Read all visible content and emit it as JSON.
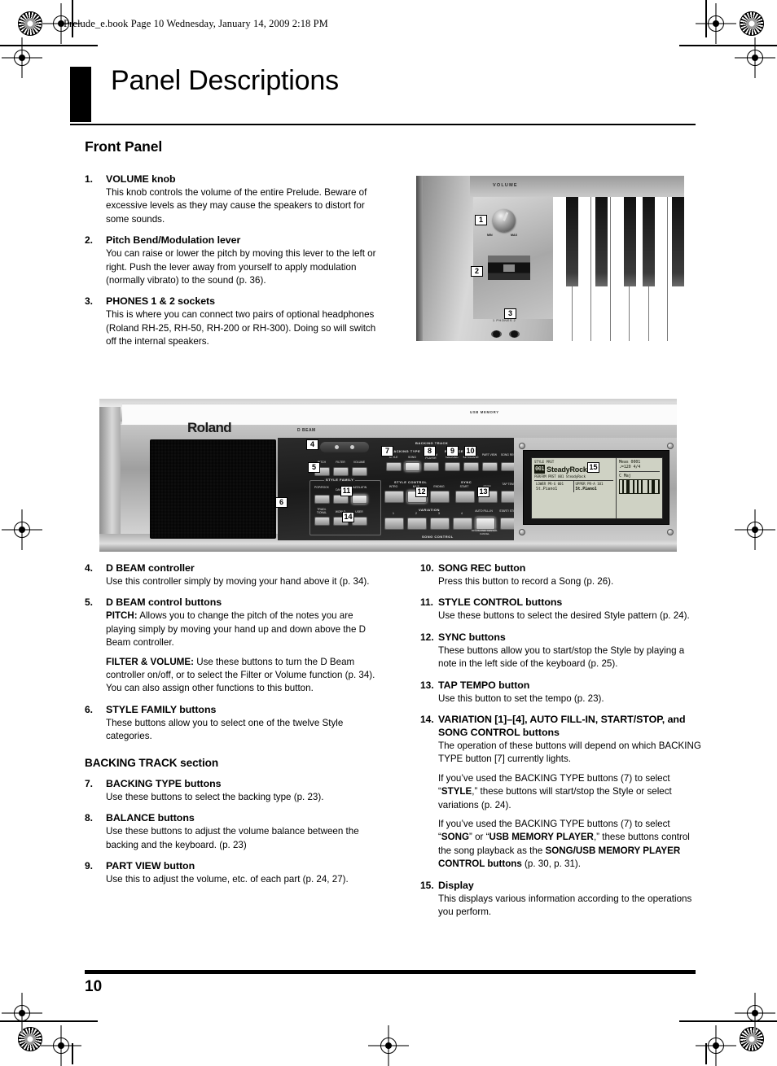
{
  "header": {
    "slug": "Prelude_e.book  Page 10  Wednesday, January 14, 2009  2:18 PM"
  },
  "title": "Panel Descriptions",
  "subhead": "Front Panel",
  "page_number": "10",
  "photo_top": {
    "volume_label": "VOLUME",
    "knob_min": "MIN",
    "knob_max": "MAX",
    "phones_label": "1   PHONES   2",
    "callouts": [
      "1",
      "2",
      "3"
    ]
  },
  "photo_panel": {
    "brand": "Roland",
    "dbeam_label": "D BEAM",
    "usb_label": "USB MEMORY",
    "groups": {
      "style_family": "STYLE FAMILY",
      "backing_type": "BACKING TYPE",
      "backing_track": "BACKING TRACK",
      "balance": "BALANCE",
      "style_control": "STYLE CONTROL",
      "sync": "SYNC",
      "variation": "VARIATION",
      "song_control": "SONG CONTROL"
    },
    "dbeam_buttons": [
      "PITCH",
      "FILTER",
      "VOLUME"
    ],
    "style_family_buttons": [
      "POP/ROCK",
      "DANCE",
      "JAZZ/LATIN",
      "TRADI-TIONAL",
      "WORLD",
      "USER"
    ],
    "backing_type_buttons": [
      "STYLE",
      "SONG",
      "USB MEM PLAYER"
    ],
    "balance_buttons": [
      "BACKING",
      "KEYBOARD"
    ],
    "part_view_button": "PART VIEW",
    "song_rec_button": "SONG REC",
    "style_control_buttons": [
      "INTRO",
      "MAIN",
      "ENDING"
    ],
    "sync_buttons": [
      "START",
      "STOP"
    ],
    "tap_tempo_button": "TAP TEMPO",
    "variation_buttons": [
      "1",
      "2",
      "3",
      "4"
    ],
    "auto_fill_in_button": "AUTO FILL-IN",
    "start_stop_button": "START/ STOP",
    "minus_one_label": "MINUS-ONE/ CENTER-CANCEL",
    "callouts": [
      "4",
      "5",
      "6",
      "7",
      "8",
      "9",
      "10",
      "11",
      "12",
      "13",
      "14",
      "15"
    ]
  },
  "lcd": {
    "mode_label": "STYLE PRST",
    "num_badge": "001",
    "style_name": "SteadyRock",
    "perform_line": "PERFRM PRST 001 SteadyRock",
    "lower_label": "LOWER PR-G",
    "lower_num": "001",
    "lower_tone": "St.Piano1",
    "upper_label": "UPPER PR-A",
    "upper_num": "101",
    "upper_tone": "St.Piano1",
    "meas": "Meas 0001",
    "tempo": "♩=120  4/4",
    "chord": "C Maj"
  },
  "left_column_top": [
    {
      "num": "1.",
      "heading": "VOLUME knob",
      "paras": [
        "This knob controls the volume of the entire Prelude. Beware of excessive levels as they may cause the speakers to distort for some sounds."
      ]
    },
    {
      "num": "2.",
      "heading": "Pitch Bend/Modulation lever",
      "paras": [
        "You can raise or lower the pitch by moving this lever to the left or right. Push the lever away from yourself to apply modulation (normally vibrato) to the sound (p. 36)."
      ]
    },
    {
      "num": "3.",
      "heading": "PHONES 1 & 2 sockets",
      "paras": [
        "This is where you can connect two pairs of optional headphones (Roland RH-25, RH-50, RH-200 or RH-300). Doing so will switch off the internal speakers."
      ]
    }
  ],
  "left_column_bottom": {
    "items_before_section": [
      {
        "num": "4.",
        "heading": "D BEAM controller",
        "paras": [
          "Use this controller simply by moving your hand above it (p. 34)."
        ]
      },
      {
        "num": "5.",
        "heading": "D BEAM control buttons",
        "paras": [
          "PITCH: Allows you to change the pitch of the notes you are playing simply by moving your hand up and down above the D Beam controller.",
          "FILTER & VOLUME: Use these buttons to turn the D Beam controller on/off, or to select the Filter or Volume function (p. 34). You can also assign other functions to this button."
        ],
        "bold_prefixes": [
          "PITCH:",
          "FILTER & VOLUME:"
        ]
      },
      {
        "num": "6.",
        "heading": "STYLE FAMILY buttons",
        "paras": [
          "These buttons allow you to select one of the twelve Style categories."
        ]
      }
    ],
    "section_heading": "BACKING TRACK section",
    "items_after_section": [
      {
        "num": "7.",
        "heading": "BACKING TYPE buttons",
        "paras": [
          "Use these buttons to select the backing type (p. 23)."
        ]
      },
      {
        "num": "8.",
        "heading": "BALANCE buttons",
        "paras": [
          "Use these buttons to adjust the volume balance between the backing and the keyboard. (p. 23)"
        ]
      },
      {
        "num": "9.",
        "heading": "PART VIEW button",
        "paras": [
          "Use this to adjust the volume, etc. of each part (p. 24, 27)."
        ]
      }
    ]
  },
  "right_column": [
    {
      "num": "10.",
      "heading": "SONG REC button",
      "paras": [
        "Press this button to record a Song (p. 26)."
      ]
    },
    {
      "num": "11.",
      "heading": "STYLE CONTROL buttons",
      "paras": [
        "Use these buttons to select the desired Style pattern (p. 24)."
      ]
    },
    {
      "num": "12.",
      "heading": "SYNC buttons",
      "paras": [
        "These buttons allow you to start/stop the Style by playing a note in the left side of the keyboard (p. 25)."
      ]
    },
    {
      "num": "13.",
      "heading": "TAP TEMPO button",
      "paras": [
        "Use this button to set the tempo (p. 23)."
      ]
    },
    {
      "num": "14.",
      "heading": "VARIATION [1]–[4], AUTO FILL-IN, START/STOP, and SONG CONTROL buttons",
      "paras": [
        "The operation of these buttons will depend on which BACKING TYPE button [7] currently lights.",
        "If you’ve used the BACKING TYPE buttons (7) to select “STYLE,” these buttons will start/stop the Style or select variations (p. 24).",
        "If you’ve used the BACKING TYPE buttons (7) to select “SONG” or “USB MEMORY PLAYER,” these buttons control the song playback as the SONG/USB MEMORY PLAYER CONTROL buttons (p. 30, p. 31)."
      ]
    },
    {
      "num": "15.",
      "heading": "Display",
      "paras": [
        "This displays various information according to the operations you perform."
      ]
    }
  ]
}
